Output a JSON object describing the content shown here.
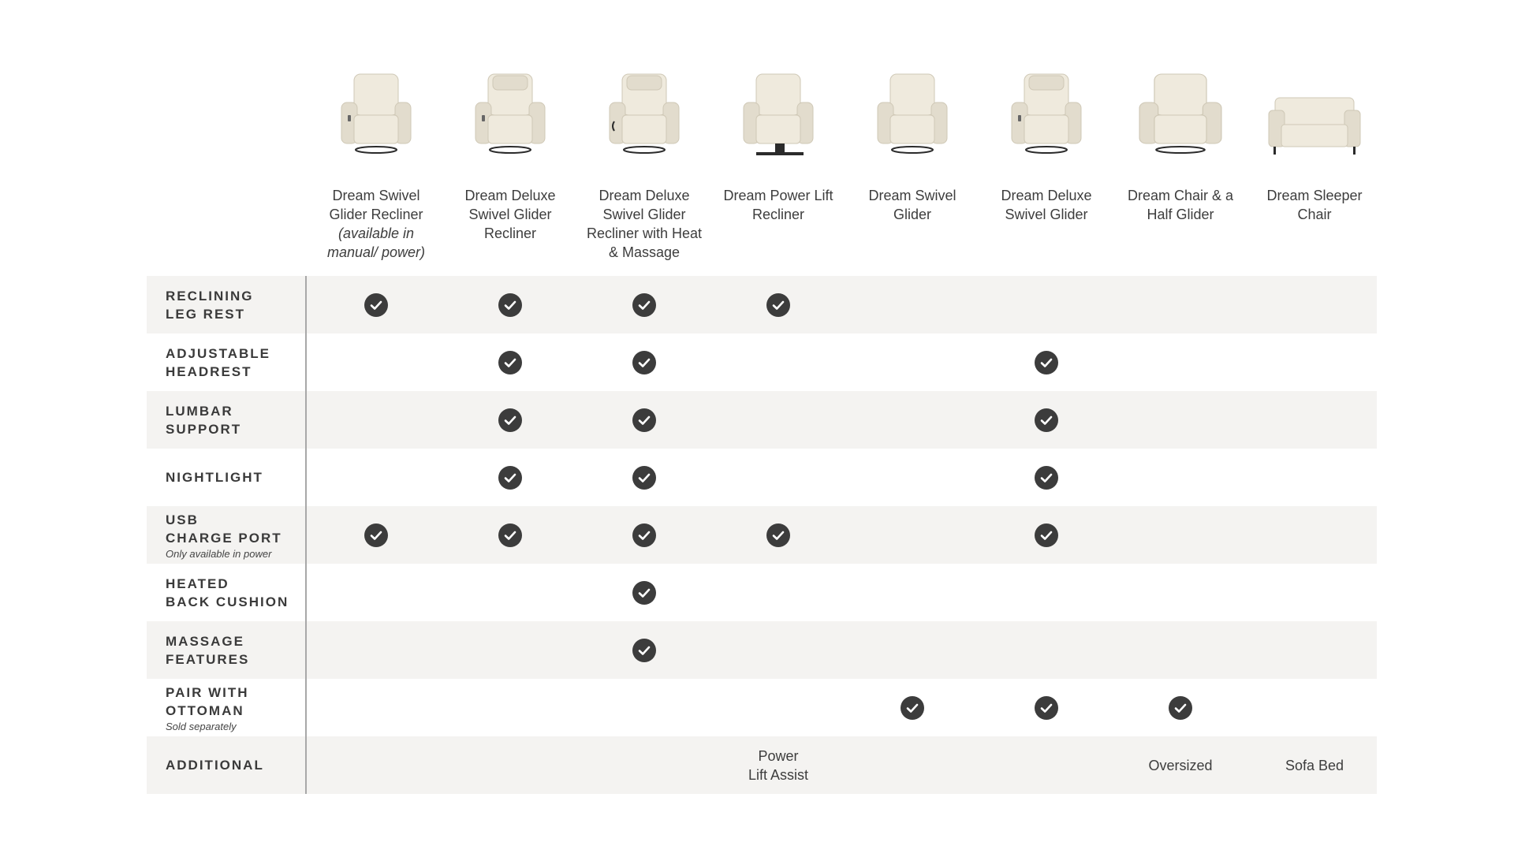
{
  "products": [
    {
      "name": "Dream Swivel Glider Recliner",
      "note": "(available in manual/ power)",
      "icon": "swivel-glider-recliner-image"
    },
    {
      "name": "Dream Deluxe Swivel Glider Recliner",
      "note": "",
      "icon": "deluxe-swivel-glider-recliner-image"
    },
    {
      "name": "Dream Deluxe Swivel Glider Recliner with Heat & Massage",
      "note": "",
      "icon": "deluxe-heat-massage-recliner-image"
    },
    {
      "name": "Dream Power Lift Recliner",
      "note": "",
      "icon": "power-lift-recliner-image"
    },
    {
      "name": "Dream Swivel Glider",
      "note": "",
      "icon": "swivel-glider-image"
    },
    {
      "name": "Dream Deluxe Swivel Glider",
      "note": "",
      "icon": "deluxe-swivel-glider-image"
    },
    {
      "name": "Dream Chair & a Half Glider",
      "note": "",
      "icon": "chair-and-a-half-glider-image"
    },
    {
      "name": "Dream Sleeper Chair",
      "note": "",
      "icon": "sleeper-chair-image"
    }
  ],
  "features": [
    {
      "label": "RECLINING\nLEG REST",
      "sub": "",
      "checks": [
        true,
        true,
        true,
        true,
        false,
        false,
        false,
        false
      ]
    },
    {
      "label": "ADJUSTABLE\nHEADREST",
      "sub": "",
      "checks": [
        false,
        true,
        true,
        false,
        false,
        true,
        false,
        false
      ]
    },
    {
      "label": "LUMBAR\nSUPPORT",
      "sub": "",
      "checks": [
        false,
        true,
        true,
        false,
        false,
        true,
        false,
        false
      ]
    },
    {
      "label": "NIGHTLIGHT",
      "sub": "",
      "checks": [
        false,
        true,
        true,
        false,
        false,
        true,
        false,
        false
      ]
    },
    {
      "label": "USB\nCHARGE PORT",
      "sub": "Only available in power",
      "checks": [
        true,
        true,
        true,
        true,
        false,
        true,
        false,
        false
      ]
    },
    {
      "label": "HEATED\nBACK CUSHION",
      "sub": "",
      "checks": [
        false,
        false,
        true,
        false,
        false,
        false,
        false,
        false
      ]
    },
    {
      "label": "MASSAGE\nFEATURES",
      "sub": "",
      "checks": [
        false,
        false,
        true,
        false,
        false,
        false,
        false,
        false
      ]
    },
    {
      "label": "PAIR WITH\nOTTOMAN",
      "sub": "Sold separately",
      "checks": [
        false,
        false,
        false,
        false,
        true,
        true,
        true,
        false
      ]
    }
  ],
  "additional": {
    "label": "ADDITIONAL",
    "values": [
      "",
      "",
      "",
      "Power\nLift Assist",
      "",
      "",
      "Oversized",
      "Sofa Bed"
    ]
  },
  "colors": {
    "check": "#3c3c3c",
    "row_shade": "#f4f3f1",
    "chair_fabric": "#efeadd",
    "text": "#3a3a3a"
  },
  "icons": {
    "check": "check-circle-icon"
  }
}
